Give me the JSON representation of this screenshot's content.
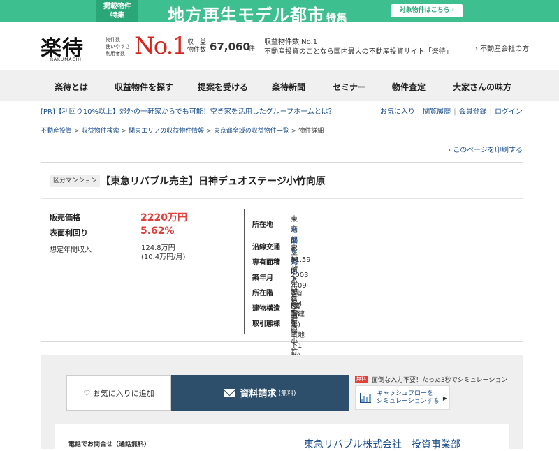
{
  "banner": {
    "badge_line1": "掲載物件",
    "badge_line2": "特集",
    "title": "地方再生モデル都市",
    "title_suffix": "特集",
    "button": "対象物件はこちら ›"
  },
  "header": {
    "logo": "楽待",
    "logo_sub": "RAKUMACHI",
    "no1_labels": [
      "物件数",
      "使いやすさ",
      "利用者数"
    ],
    "no1": "No.1",
    "count_label1": "収　益",
    "count_label2": "物件数",
    "count_value": "67,060",
    "count_unit": "件",
    "desc_line1": "収益物件数 No.1",
    "desc_line2": "不動産投資のことなら国内最大の不動産投資サイト「楽待」",
    "realtor_link": "› 不動産会社の方"
  },
  "nav": [
    "楽待とは",
    "収益物件を探す",
    "提案を受ける",
    "楽待新聞",
    "セミナー",
    "物件査定",
    "大家さんの味方"
  ],
  "subbar": {
    "pr": "[PR]【利回り10%以上】郊外の一軒家からでも可能！空き家を活用したグループホームとは？",
    "links": [
      "お気に入り",
      "閲覧履歴",
      "会員登録",
      "ログイン"
    ]
  },
  "breadcrumbs": [
    "不動産投資",
    "収益物件検索",
    "関東エリアの収益物件情報",
    "東京都全域の収益物件一覧",
    "物件詳細"
  ],
  "print_link": "› このページを印刷する",
  "property": {
    "type_tag": "区分マンション",
    "title": "【東急リバブル売主】日神デュオステージ小竹向原",
    "price_label": "販売価格",
    "price": "2220万円",
    "yield_label": "表面利回り",
    "yield": "5.62%",
    "income_label": "想定年間収入",
    "income_line1": "124.8万円",
    "income_line2": "(10.4万円/月)",
    "details": [
      {
        "key": "所在地",
        "value": "東京都板橋区小茂根１丁目",
        "extra": "地図を見る ↗"
      },
      {
        "key": "沿線交通",
        "value": "東京メトロ有楽町線 小竹向原駅 徒歩4分"
      },
      {
        "key": "専有面積",
        "value": "31.59㎡"
      },
      {
        "key": "築年月",
        "value": "2003年09月　(築18年)"
      },
      {
        "key": "所在階",
        "value": "3階／4階建て（地下1階）"
      },
      {
        "key": "建物構造",
        "value": "RC造"
      },
      {
        "key": "取引態様",
        "value": "売主"
      }
    ]
  },
  "actions": {
    "favorite": "♡ お気に入りに追加",
    "request": "資料請求",
    "request_suffix": "(無料)",
    "free_tag": "無料",
    "sim_note": "面倒な入力不要！たった3秒でシミュレーション",
    "sim_line1": "キャッシュフローを",
    "sim_line2": "シミュレーションする",
    "contact_label": "電話でお問合せ（通話無料）",
    "company": "東急リバブル株式会社　投資事業部"
  }
}
